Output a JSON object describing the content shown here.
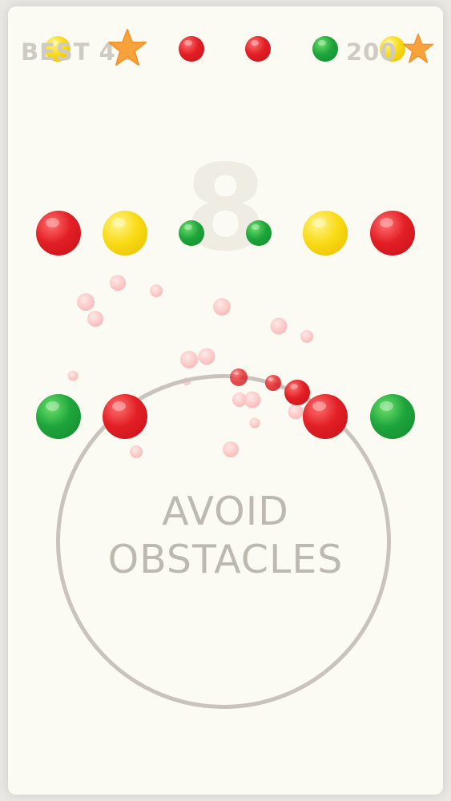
{
  "hud": {
    "best_label": "BEST 42",
    "coins_label": "200"
  },
  "score": "8",
  "hint": {
    "line1": "AVOID",
    "line2": "OBSTACLES"
  },
  "colors": {
    "red": "#e21f25",
    "yellow": "#f9db16",
    "green": "#1ea53c",
    "star": "#f7a23a",
    "ring": "#c9c2bd",
    "background": "#fcfbf3"
  },
  "icons": [
    "star-icon"
  ]
}
